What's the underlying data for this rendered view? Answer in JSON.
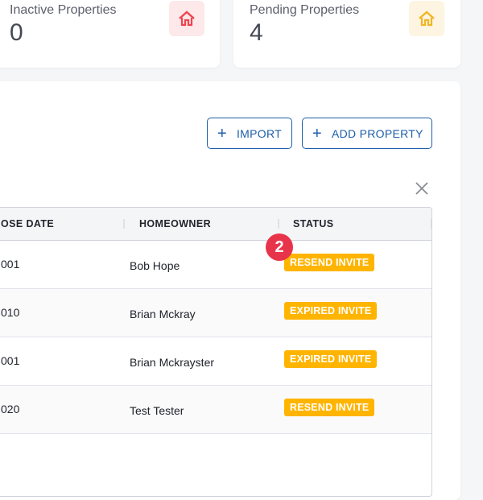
{
  "stat_cards": [
    {
      "label": "Inactive Properties",
      "value": "0",
      "icon": "home-icon",
      "color": "#f0444f",
      "bg": "#fde8ea"
    },
    {
      "label": "Pending Properties",
      "value": "4",
      "icon": "home-icon",
      "color": "#f2b526",
      "bg": "#fdf5e1"
    }
  ],
  "toolbar": {
    "import_label": "IMPORT",
    "add_property_label": "ADD PROPERTY",
    "plus_glyph": "+"
  },
  "table": {
    "columns": [
      "OSE DATE",
      "HOMEOWNER",
      "STATUS"
    ],
    "rows": [
      {
        "close_date": "001",
        "homeowner": "Bob Hope",
        "status": "RESEND INVITE"
      },
      {
        "close_date": "010",
        "homeowner": "Brian Mckray",
        "status": "EXPIRED INVITE"
      },
      {
        "close_date": "001",
        "homeowner": "Brian Mckrayster",
        "status": "EXPIRED INVITE"
      },
      {
        "close_date": "020",
        "homeowner": "Test Tester",
        "status": "RESEND INVITE"
      }
    ]
  },
  "step_marker": "2",
  "colors": {
    "accent": "#1c5ea8",
    "badge": "#ffb400",
    "marker": "#e8344a"
  }
}
